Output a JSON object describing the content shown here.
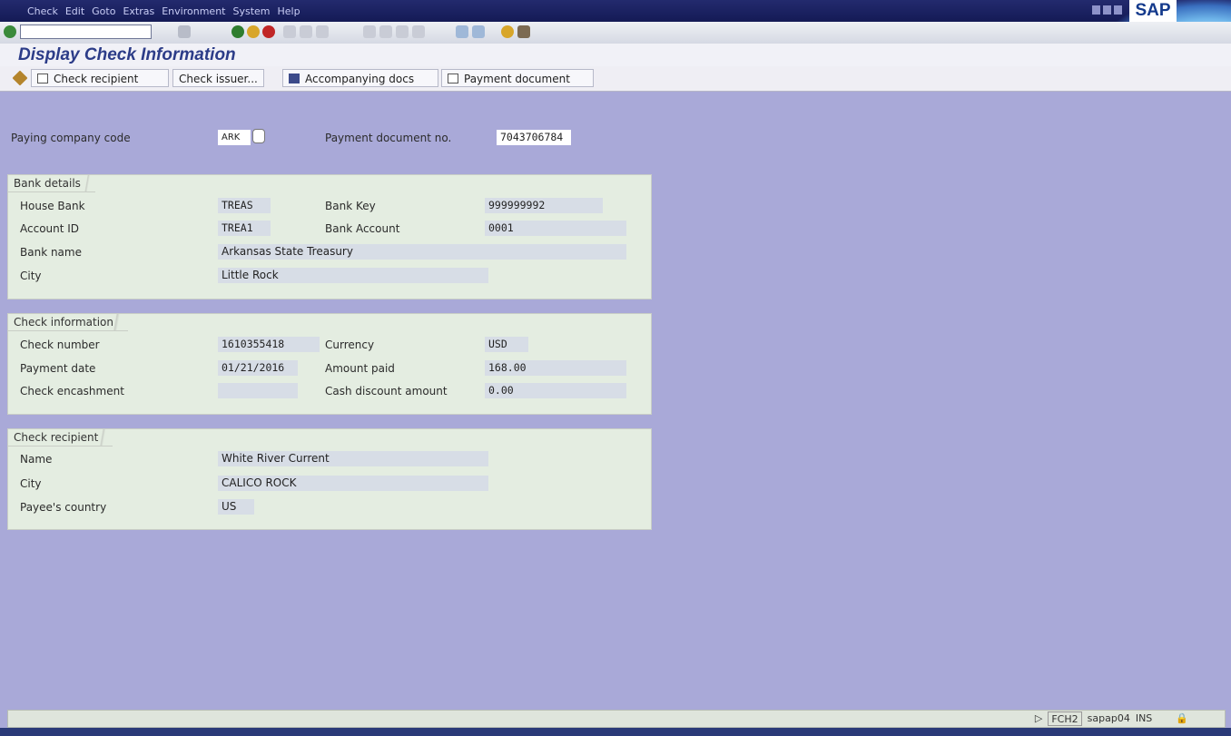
{
  "menu": {
    "items": [
      "Check",
      "Edit",
      "Goto",
      "Extras",
      "Environment",
      "System",
      "Help"
    ]
  },
  "logo": "SAP",
  "screen_title": "Display Check Information",
  "app_toolbar": {
    "check_recipient": "Check recipient",
    "check_issuer": "Check issuer...",
    "accompanying_docs": "Accompanying docs",
    "payment_document": "Payment document"
  },
  "header": {
    "paying_company_code_label": "Paying company code",
    "paying_company_code": "ARK",
    "payment_doc_no_label": "Payment document no.",
    "payment_doc_no": "7043706784"
  },
  "bank_details": {
    "title": "Bank details",
    "house_bank_label": "House Bank",
    "house_bank": "TREAS",
    "bank_key_label": "Bank Key",
    "bank_key": "999999992",
    "account_id_label": "Account ID",
    "account_id": "TREA1",
    "bank_account_label": "Bank Account",
    "bank_account": "0001",
    "bank_name_label": "Bank name",
    "bank_name": "Arkansas State Treasury",
    "city_label": "City",
    "city": "Little Rock"
  },
  "check_info": {
    "title": "Check information",
    "check_number_label": "Check number",
    "check_number": "1610355418",
    "currency_label": "Currency",
    "currency": "USD",
    "payment_date_label": "Payment date",
    "payment_date": "01/21/2016",
    "amount_paid_label": "Amount paid",
    "amount_paid": "168.00",
    "check_encashment_label": "Check encashment",
    "check_encashment": "",
    "cash_discount_label": "Cash discount amount",
    "cash_discount": "0.00"
  },
  "check_recipient": {
    "title": "Check recipient",
    "name_label": "Name",
    "name": "White River Current",
    "city_label": "City",
    "city": "CALICO ROCK",
    "country_label": "Payee's country",
    "country": "US"
  },
  "status_bar": {
    "transaction": "FCH2",
    "server": "sapap04",
    "mode": "INS"
  }
}
